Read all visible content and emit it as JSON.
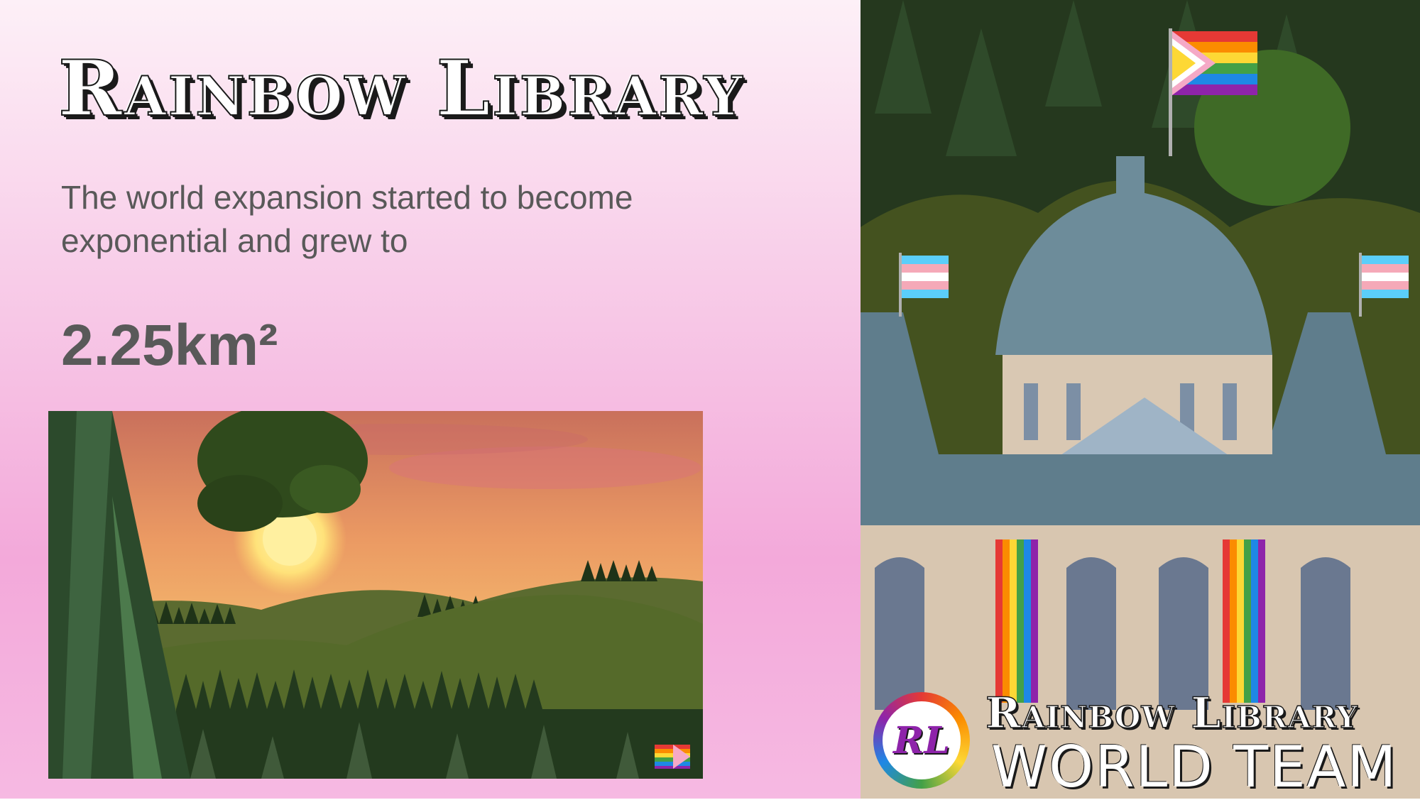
{
  "slide": {
    "title": "Rainbow Library",
    "body": "The world expansion started to become exponential and grew to",
    "value": "2.25km²"
  },
  "branding": {
    "badge_initials": "RL",
    "line1": "Rainbow Library",
    "line2": "WORLD TEAM"
  },
  "colors": {
    "background_top": "#fdf0f7",
    "background_bottom": "#f3a9da",
    "text": "#595959"
  },
  "images": {
    "landscape": "sunset-forest-hills",
    "building": "domed-library-with-pride-flags"
  }
}
